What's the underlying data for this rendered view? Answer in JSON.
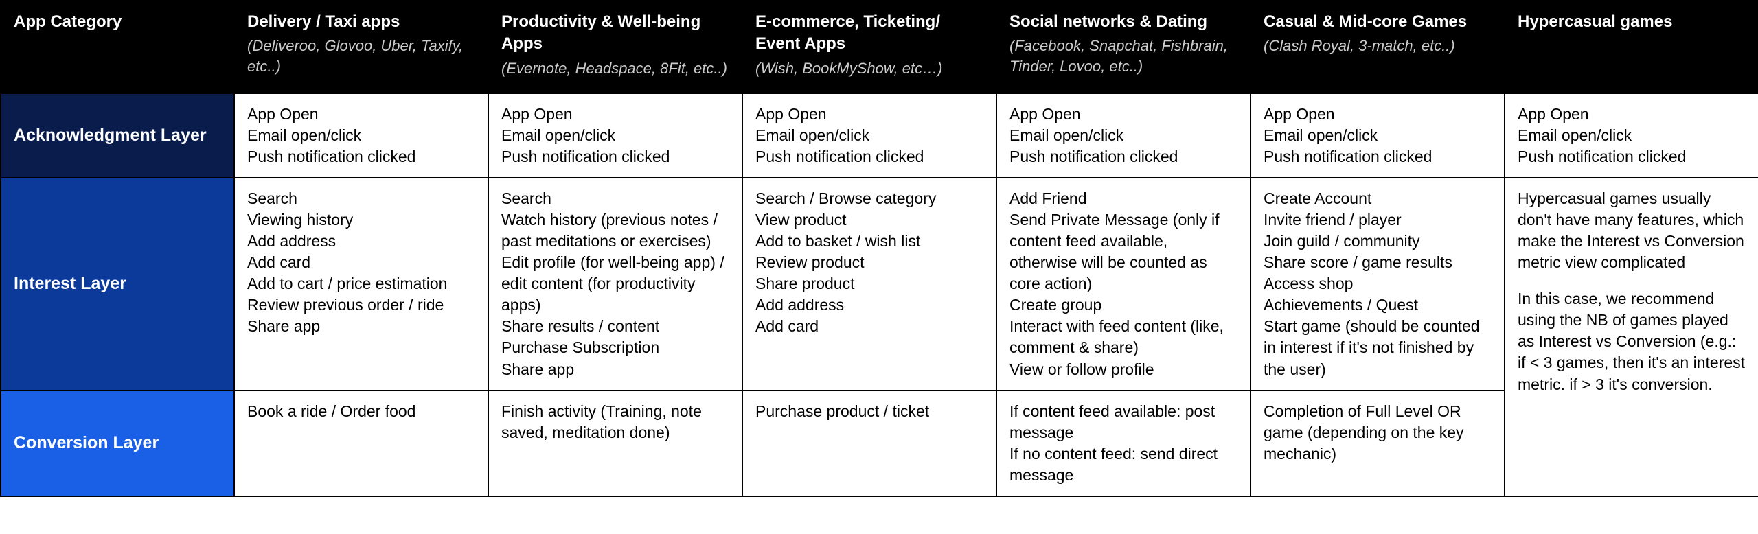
{
  "header": {
    "corner": "App Category",
    "columns": [
      {
        "title": "Delivery / Taxi apps",
        "sub": "(Deliveroo, Glovoo, Uber, Taxify, etc..)"
      },
      {
        "title": "Productivity & Well-being Apps",
        "sub": "(Evernote, Headspace, 8Fit, etc..)"
      },
      {
        "title": "E-commerce, Ticketing/ Event Apps",
        "sub": "(Wish, BookMyShow, etc…)"
      },
      {
        "title": "Social networks & Dating",
        "sub": "(Facebook, Snapchat, Fishbrain, Tinder, Lovoo, etc..)"
      },
      {
        "title": "Casual & Mid-core Games",
        "sub": "(Clash Royal, 3-match, etc..)"
      },
      {
        "title": "Hypercasual games",
        "sub": ""
      }
    ]
  },
  "rows": {
    "ack": {
      "label": "Acknowledgment Layer",
      "cells": [
        [
          "App Open",
          "Email open/click",
          "Push notification clicked"
        ],
        [
          "App Open",
          "Email open/click",
          "Push notification clicked"
        ],
        [
          "App Open",
          "Email open/click",
          "Push notification clicked"
        ],
        [
          "App Open",
          "Email open/click",
          "Push notification clicked"
        ],
        [
          "App Open",
          "Email open/click",
          "Push notification clicked"
        ],
        [
          "App Open",
          "Email open/click",
          "Push notification clicked"
        ]
      ]
    },
    "interest": {
      "label": "Interest Layer",
      "cells": [
        [
          "Search",
          "Viewing history",
          "Add address",
          "Add card",
          "Add to cart / price estimation",
          "Review previous order / ride",
          "Share app"
        ],
        [
          "Search",
          "Watch history (previous notes / past meditations or exercises)",
          "Edit profile (for well-being app) / edit content (for productivity apps)",
          "Share results / content",
          "Purchase Subscription",
          "Share app"
        ],
        [
          "Search / Browse category",
          "View product",
          "Add to basket / wish list",
          "Review product",
          "Share product",
          "Add address",
          "Add card"
        ],
        [
          "Add Friend",
          "Send Private Message (only if content feed available, otherwise will be counted as core action)",
          "Create group",
          "Interact with feed content (like, comment & share)",
          "View or follow profile"
        ],
        [
          "Create Account",
          "Invite friend / player",
          "Join guild / community",
          "Share score / game results",
          "Access shop",
          "Achievements / Quest",
          "Start game (should be counted in interest if it's not finished by the user)"
        ]
      ]
    },
    "conv": {
      "label": "Conversion Layer",
      "cells": [
        [
          "Book a ride / Order food"
        ],
        [
          "Finish activity (Training, note saved, meditation done)"
        ],
        [
          "Purchase product / ticket"
        ],
        [
          "If content feed available: post message",
          "If no content feed: send direct message"
        ],
        [
          "Completion of Full Level OR game (depending on the key mechanic)"
        ]
      ]
    },
    "hypercasual_combined": {
      "paras": [
        "Hypercasual games usually don't have many features, which make the Interest vs Conversion metric view complicated",
        "In this case, we recommend using the NB of games played as Interest vs Conversion (e.g.: if < 3 games, then it's an interest metric. if > 3 it's conversion."
      ]
    }
  }
}
